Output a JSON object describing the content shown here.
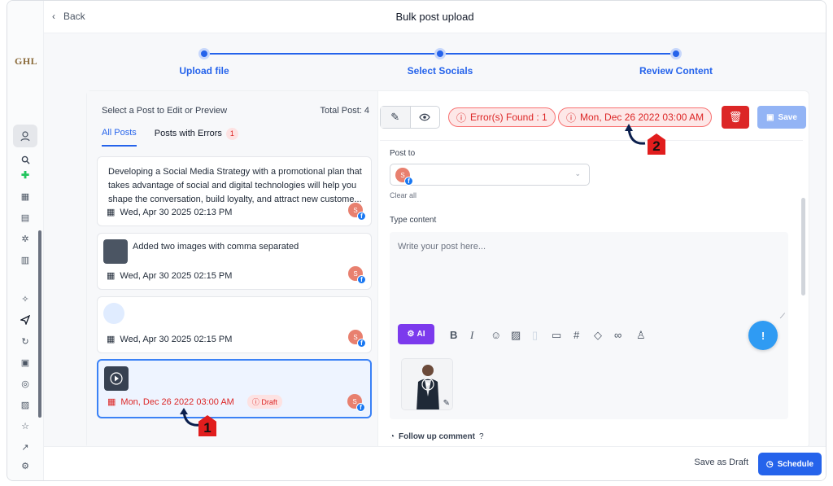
{
  "app": {
    "logo": "GHL",
    "title": "Bulk post upload",
    "back_label": "Back"
  },
  "steps": [
    {
      "label": "Upload file"
    },
    {
      "label": "Select Socials"
    },
    {
      "label": "Review Content"
    }
  ],
  "list": {
    "header": "Select a Post to Edit or Preview",
    "total": "Total Post: 4",
    "tabs": [
      {
        "label": "All Posts",
        "active": true
      },
      {
        "label": "Posts with Errors",
        "count": "1"
      }
    ],
    "posts": [
      {
        "text": "Developing a Social Media Strategy with a promotional plan that takes advantage of social and digital technologies will help you shape the conversation, build loyalty, and attract new custome...",
        "date": "Wed, Apr 30 2025 02:13 PM"
      },
      {
        "text": "Added two images with comma separated",
        "date": "Wed, Apr 30 2025 02:15 PM"
      },
      {
        "text": "",
        "date": "Wed, Apr 30 2025 02:15 PM"
      },
      {
        "text": "",
        "date": "Mon, Dec 26 2022 03:00 AM",
        "badge": "Draft",
        "selected": true,
        "error": true
      }
    ],
    "avatar_initial": "S"
  },
  "toolbar": {
    "errors_found": "Error(s) Found : 1",
    "date_error": "Mon, Dec 26 2022 03:00 AM",
    "save_label": "Save"
  },
  "editor": {
    "post_to_label": "Post to",
    "clear_all": "Clear all",
    "type_content_label": "Type content",
    "placeholder": "Write your post here...",
    "ai_label": "AI",
    "follow_up": "Follow up comment"
  },
  "footer": {
    "save_draft": "Save as Draft",
    "schedule": "Schedule"
  },
  "annotations": {
    "marker1": "1",
    "marker2": "2"
  },
  "colors": {
    "accent": "#2563eb",
    "error": "#dc2626",
    "ai": "#7c3aed"
  }
}
